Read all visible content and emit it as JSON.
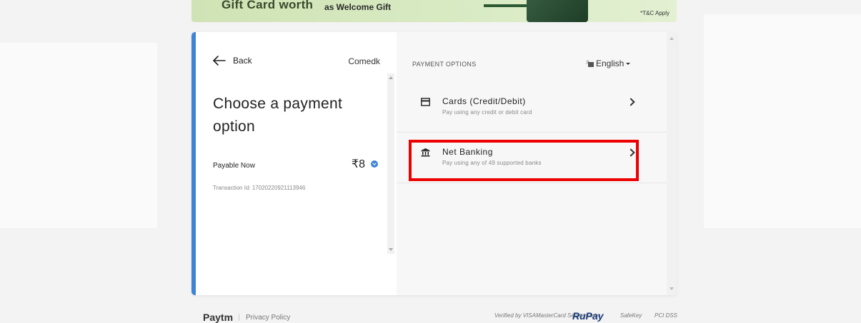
{
  "banner": {
    "text_left": "Gift Card worth",
    "text_right": "as Welcome Gift",
    "tc": "*T&C Apply"
  },
  "left_panel": {
    "back_label": "Back",
    "merchant": "Comedk",
    "title": "Choose a payment option",
    "payable_label": "Payable Now",
    "amount": "₹8",
    "transaction_id": "Transaction Id: 17020220921113946"
  },
  "right_panel": {
    "header": "PAYMENT OPTIONS",
    "language": "English",
    "options": [
      {
        "title": "Cards (Credit/Debit)",
        "subtitle": "Pay using any credit or debit card",
        "icon": "credit-card-icon"
      },
      {
        "title": "Net Banking",
        "subtitle": "Pay using any of 49 supported banks",
        "icon": "bank-icon"
      }
    ],
    "highlight_color": "#ee0000"
  },
  "footer": {
    "brand": "Paytm",
    "privacy": "Privacy Policy",
    "badges": [
      "Verified by VISA",
      "MasterCard SecureCode",
      "RuPay",
      "SafeKey",
      "PCI DSS"
    ]
  },
  "colors": {
    "accent": "#3f83d5",
    "background": "#f3f3f3"
  }
}
